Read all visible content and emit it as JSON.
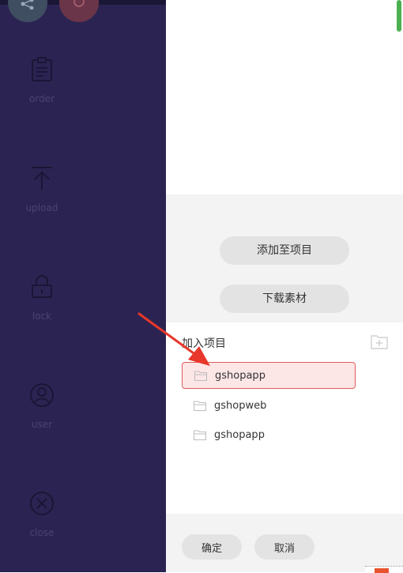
{
  "sidebar": {
    "items": [
      {
        "label": "order",
        "icon": "clipboard-icon"
      },
      {
        "label": "upload",
        "icon": "upload-icon"
      },
      {
        "label": "lock",
        "icon": "lock-icon"
      },
      {
        "label": "user",
        "icon": "user-icon"
      },
      {
        "label": "close",
        "icon": "close-icon"
      }
    ]
  },
  "actions": {
    "add_to_project": "添加至项目",
    "download_material": "下载素材"
  },
  "project_list": {
    "title": "加入项目",
    "items": [
      {
        "name": "gshopapp",
        "selected": true
      },
      {
        "name": "gshopweb",
        "selected": false
      },
      {
        "name": "gshopapp",
        "selected": false
      }
    ]
  },
  "footer": {
    "confirm": "确定",
    "cancel": "取消"
  },
  "colors": {
    "sidebar_bg": "#2b2452",
    "selected_border": "#e05a5a",
    "selected_bg": "#fde6e6",
    "arrow": "#e8372b",
    "scroll_thumb": "#4caf50"
  }
}
